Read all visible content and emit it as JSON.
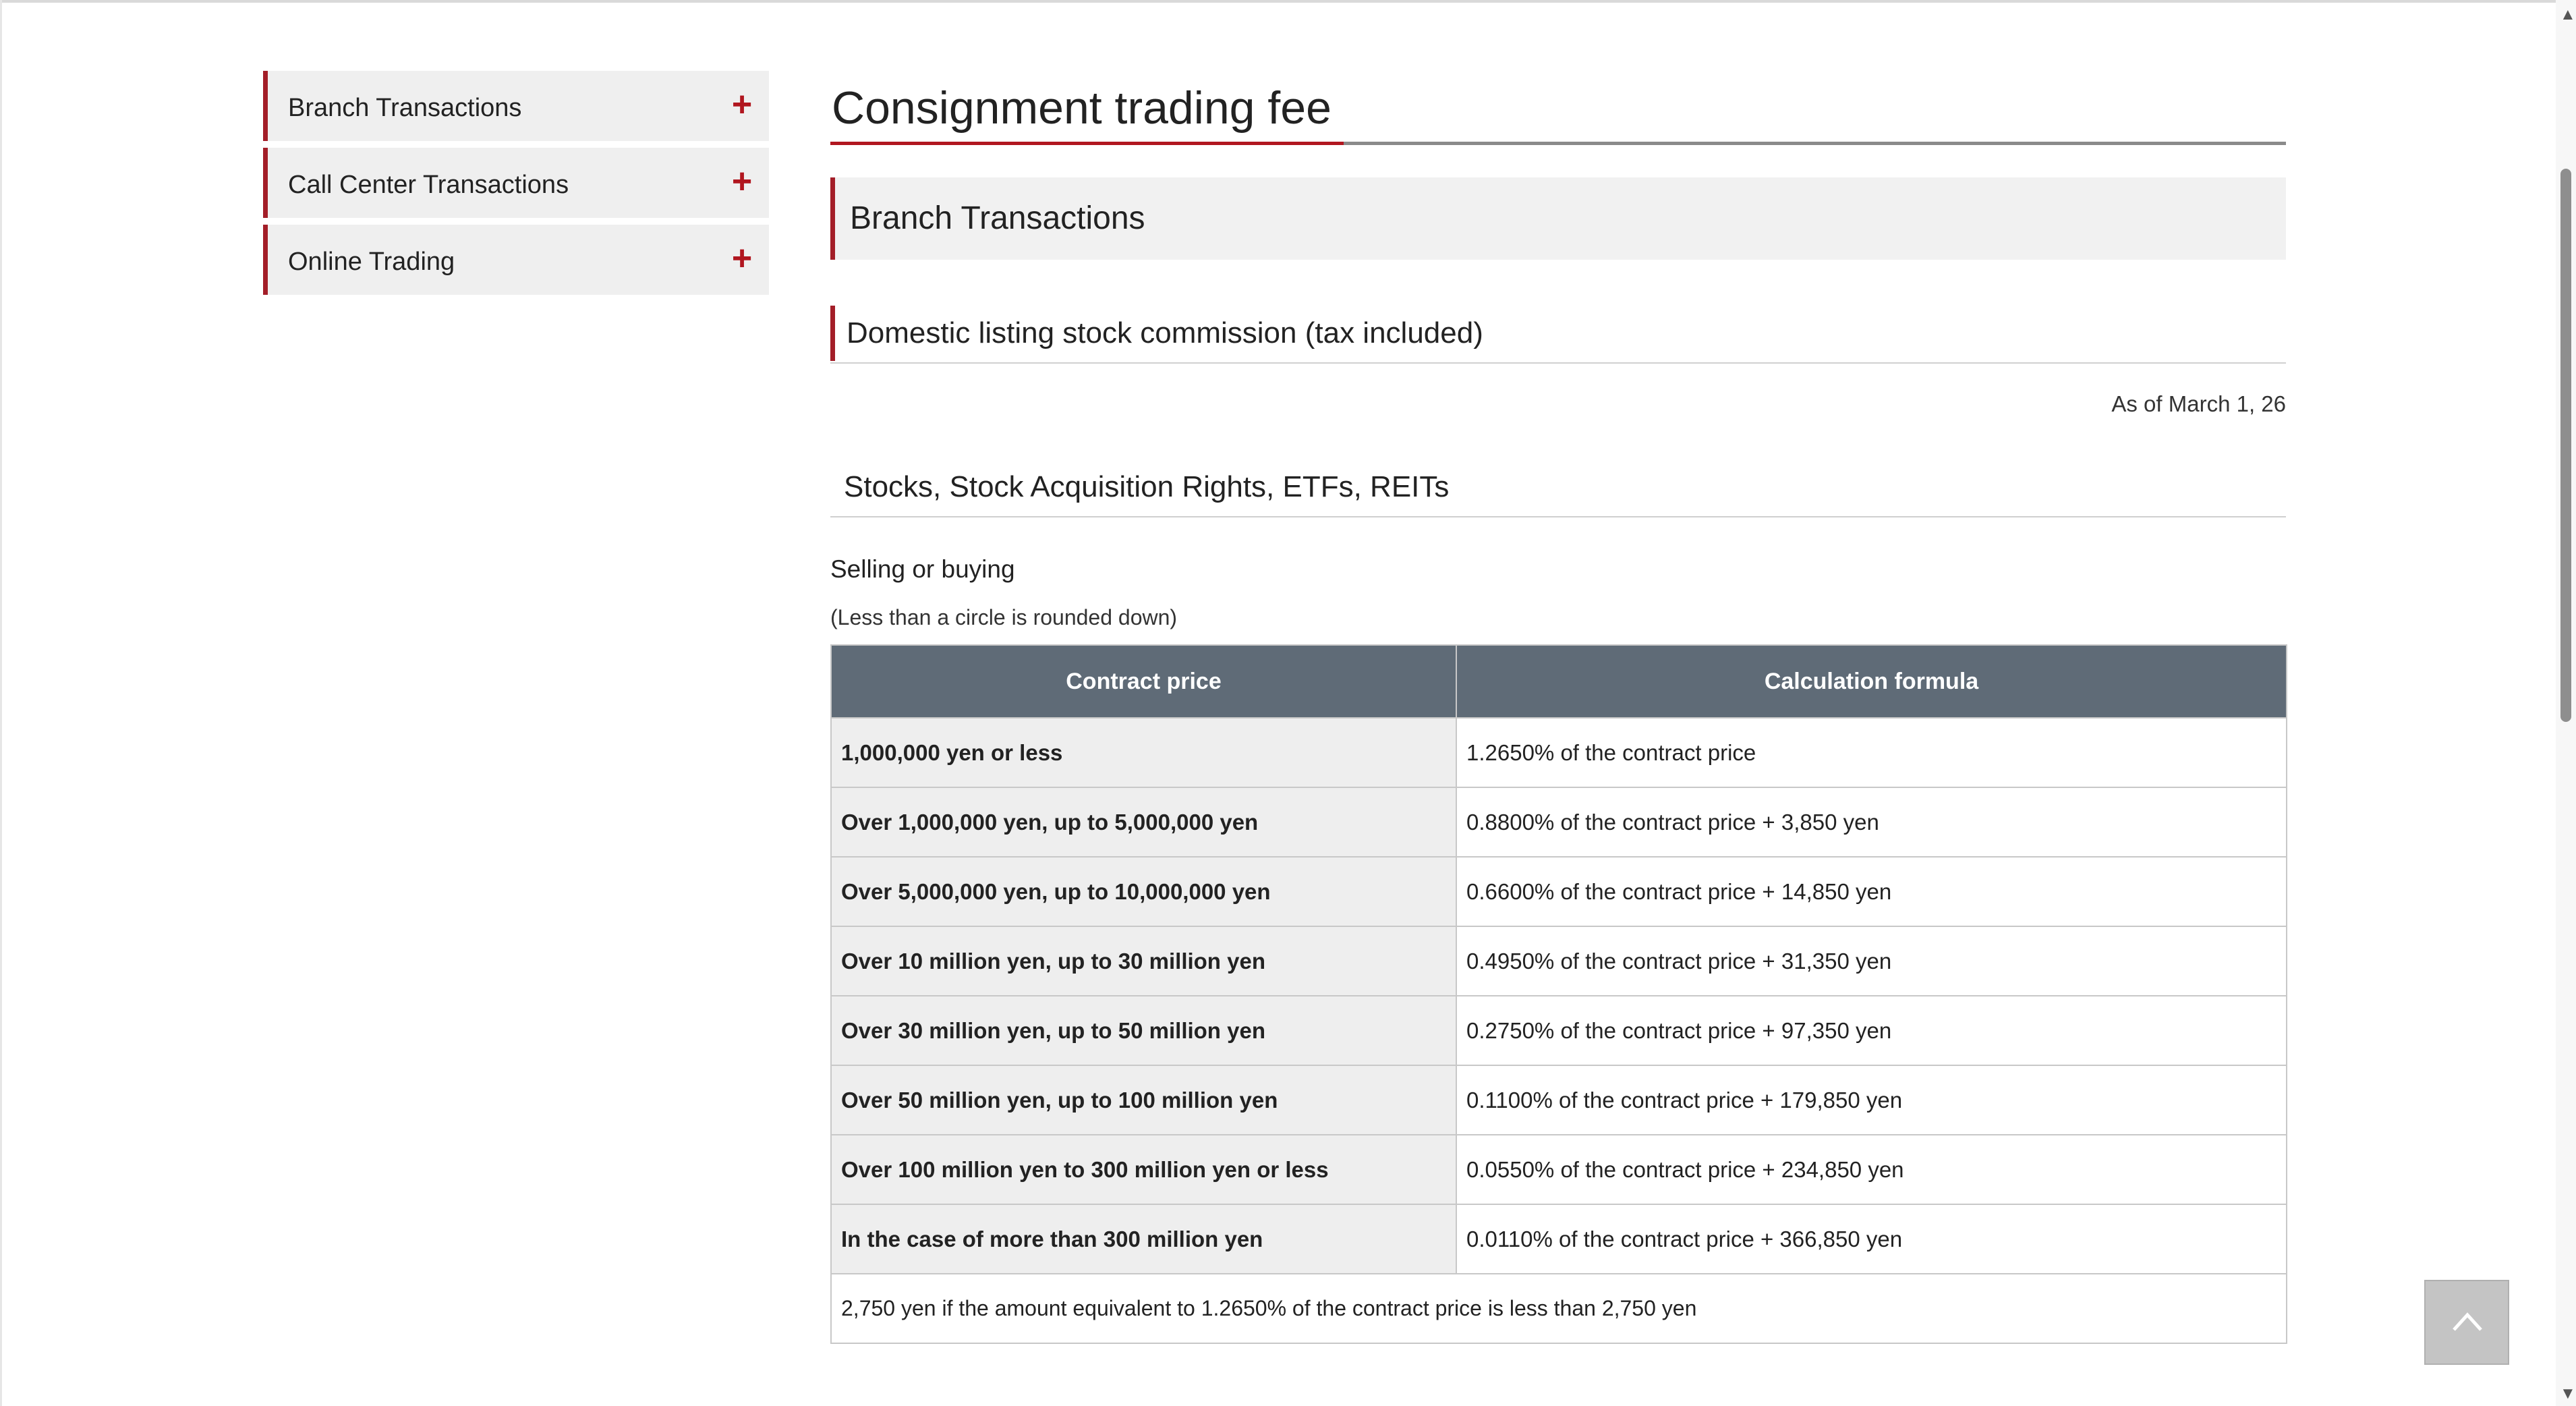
{
  "sidebar": {
    "items": [
      {
        "label": "Branch Transactions"
      },
      {
        "label": "Call Center Transactions"
      },
      {
        "label": "Online Trading"
      }
    ]
  },
  "main": {
    "title": "Consignment trading fee",
    "section_title": "Branch Transactions",
    "subsection_title": "Domestic listing stock commission (tax included)",
    "as_of": "As of March 1, 26",
    "category_title": "Stocks, Stock Acquisition Rights, ETFs, REITs",
    "selling_label": "Selling or buying",
    "rounding_note": "(Less than a circle is rounded down)",
    "table": {
      "headers": [
        "Contract price",
        "Calculation formula"
      ],
      "rows": [
        {
          "price": "1,000,000 yen or less",
          "formula": "1.2650% of the contract price"
        },
        {
          "price": "Over 1,000,000 yen, up to 5,000,000 yen",
          "formula": "0.8800% of the contract price + 3,850 yen"
        },
        {
          "price": "Over 5,000,000 yen, up to 10,000,000 yen",
          "formula": "0.6600% of the contract price + 14,850 yen"
        },
        {
          "price": "Over 10 million yen, up to 30 million yen",
          "formula": "0.4950% of the contract price + 31,350 yen"
        },
        {
          "price": "Over 30 million yen, up to 50 million yen",
          "formula": "0.2750% of the contract price + 97,350 yen"
        },
        {
          "price": "Over 50 million yen, up to 100 million yen",
          "formula": "0.1100% of the contract price + 179,850 yen"
        },
        {
          "price": "Over 100 million yen to 300 million yen or less",
          "formula": "0.0550% of the contract price + 234,850 yen"
        },
        {
          "price": "In the case of more than 300 million yen",
          "formula": "0.0110% of the contract price + 366,850 yen"
        }
      ],
      "footnote": "2,750 yen if the amount equivalent to 1.2650% of the contract price is less than 2,750 yen"
    }
  },
  "icons": {
    "expand": "plus-icon",
    "back_to_top": "chevron-up-icon"
  },
  "colors": {
    "accent": "#b1161f",
    "table_header": "#5f6b77"
  }
}
